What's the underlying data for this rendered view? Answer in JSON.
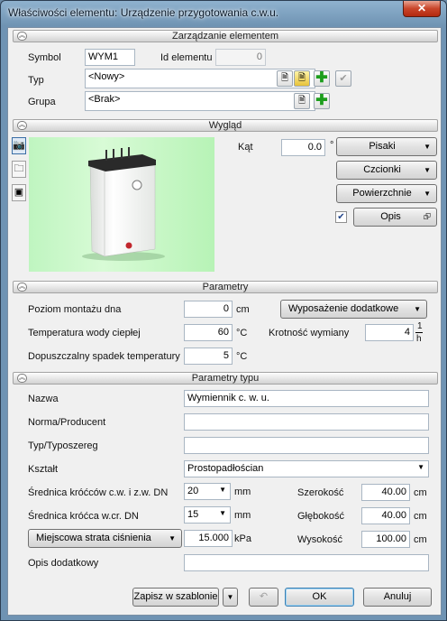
{
  "window": {
    "title": "Właściwości elementu: Urządzenie przygotowania c.w.u.",
    "close_glyph": "✕"
  },
  "sections": {
    "management": "Zarządzanie elementem",
    "appearance": "Wygląd",
    "parameters": "Parametry",
    "type_parameters": "Parametry typu"
  },
  "management": {
    "symbol_label": "Symbol",
    "symbol_value": "WYM1",
    "id_label": "Id elementu",
    "id_value": "0",
    "type_label": "Typ",
    "type_value": "<Nowy>",
    "group_label": "Grupa",
    "group_value": "<Brak>"
  },
  "appearance": {
    "angle_label": "Kąt",
    "angle_value": "0.0",
    "angle_unit": "°",
    "pens_label": "Pisaki",
    "fonts_label": "Czcionki",
    "surfaces_label": "Powierzchnie",
    "description_checked": true,
    "description_label": "Opis"
  },
  "parameters": {
    "mount_label": "Poziom montażu dna",
    "mount_value": "0",
    "mount_unit": "cm",
    "temp_label": "Temperatura wody ciepłej",
    "temp_value": "60",
    "temp_unit": "°C",
    "drop_label": "Dopuszczalny spadek temperatury",
    "drop_value": "5",
    "drop_unit": "°C",
    "equipment_label": "Wyposażenie dodatkowe",
    "exchange_label": "Krotność wymiany",
    "exchange_value": "4",
    "exchange_unit_top": "1",
    "exchange_unit_bottom": "h"
  },
  "type_parameters": {
    "name_label": "Nazwa",
    "name_value": "Wymiennik c. w. u.",
    "norm_label": "Norma/Producent",
    "norm_value": "",
    "series_label": "Typ/Typoszereg",
    "series_value": "",
    "shape_label": "Kształt",
    "shape_value": "Prostopadłościan",
    "dn_cw_label": "Średnica króćców c.w. i z.w. DN",
    "dn_cw_value": "20",
    "dn_cw_unit": "mm",
    "dn_wcr_label": "Średnica króćca w.cr. DN",
    "dn_wcr_value": "15",
    "dn_wcr_unit": "mm",
    "loss_label": "Miejscowa strata ciśnienia",
    "loss_value": "15.000",
    "loss_unit": "kPa",
    "width_label": "Szerokość",
    "width_value": "40.00",
    "width_unit": "cm",
    "depth_label": "Głębokość",
    "depth_value": "40.00",
    "depth_unit": "cm",
    "height_label": "Wysokość",
    "height_value": "100.00",
    "height_unit": "cm",
    "extra_label": "Opis dodatkowy",
    "extra_value": ""
  },
  "footer": {
    "save_template": "Zapisz w szablonie",
    "ok": "OK",
    "cancel": "Anuluj"
  },
  "colors": {
    "preview_bg": "#c6f7c4",
    "plus_green": "#1d9e1d"
  }
}
